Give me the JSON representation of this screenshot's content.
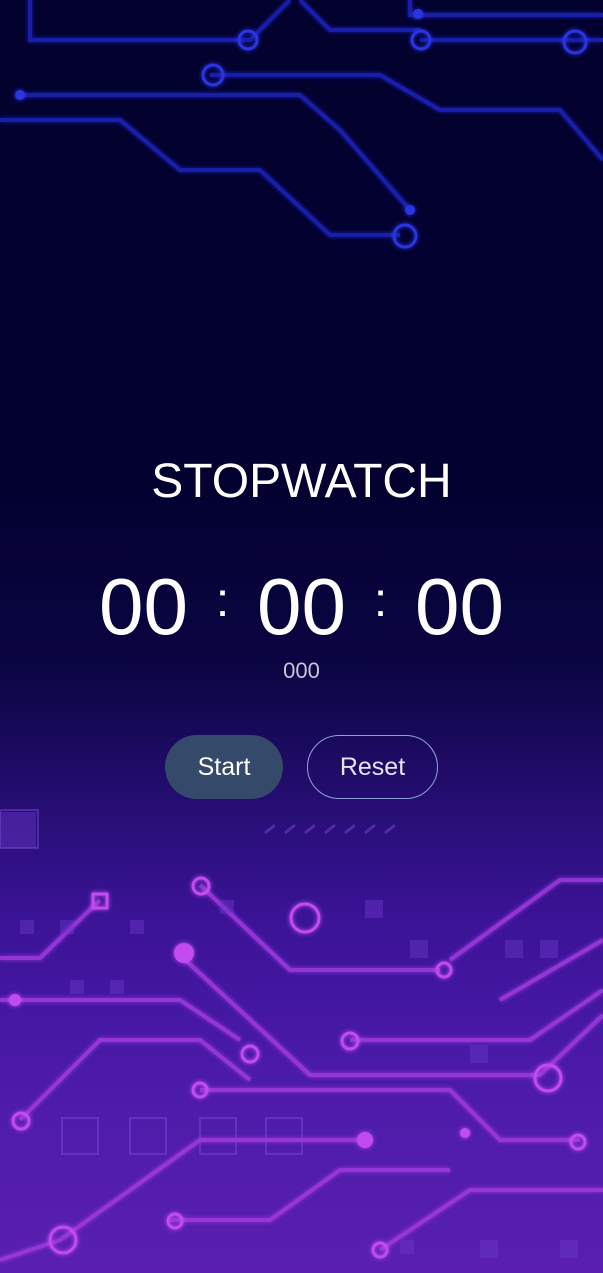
{
  "app": {
    "title": "STOPWATCH"
  },
  "display": {
    "hours": "00",
    "minutes": "00",
    "seconds": "00",
    "separator": ":",
    "milliseconds": "000"
  },
  "controls": {
    "start_label": "Start",
    "reset_label": "Reset"
  },
  "colors": {
    "background_top": "#03012e",
    "background_bottom": "#5a1fb0",
    "start_button": "#354a6b",
    "reset_border": "#8fa0d6",
    "text": "#ffffff"
  }
}
